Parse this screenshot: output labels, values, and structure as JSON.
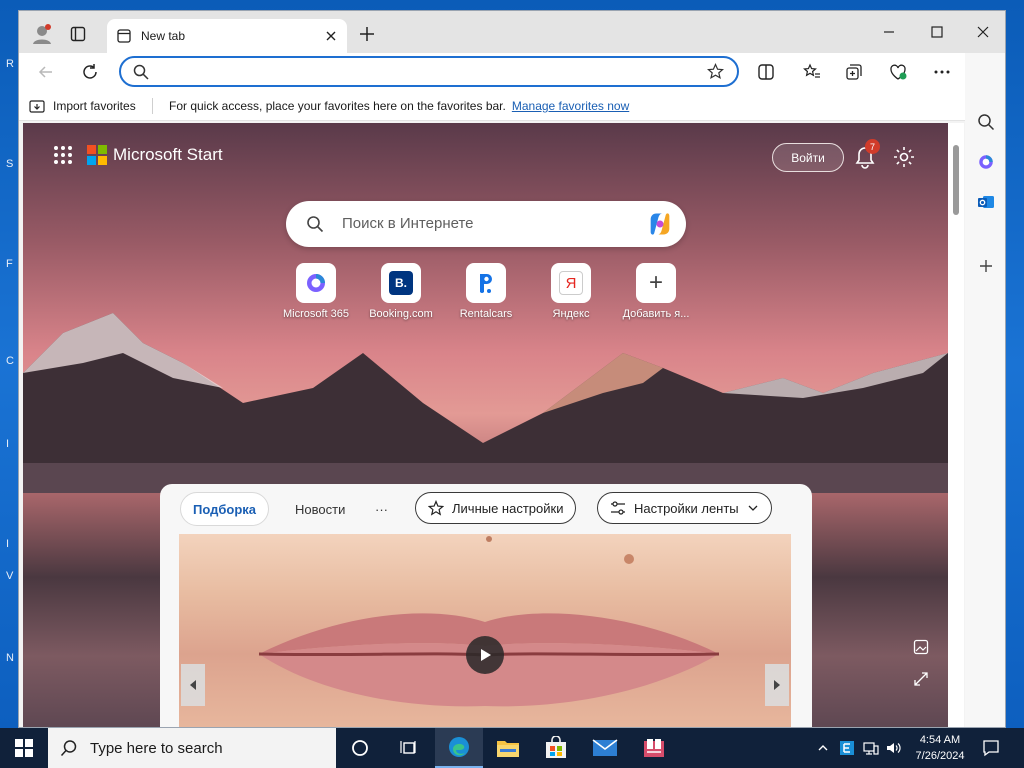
{
  "desktop": {
    "letters": [
      {
        "text": "R"
      },
      {
        "text": "S"
      },
      {
        "text": "F"
      },
      {
        "text": "C"
      },
      {
        "text": "I"
      },
      {
        "text": "I"
      },
      {
        "text": "V"
      },
      {
        "text": "N"
      }
    ]
  },
  "browser": {
    "tab": {
      "title": "New tab"
    },
    "address": {
      "value": "",
      "placeholder": ""
    },
    "favorites_bar": {
      "import_label": "Import favorites",
      "prompt_text": "For quick access, place your favorites here on the favorites bar.",
      "manage_link": "Manage favorites now"
    }
  },
  "start_page": {
    "brand": "Microsoft Start",
    "sign_in_label": "Войти",
    "notification_count": "7",
    "search": {
      "placeholder": "Поиск в Интернете"
    },
    "quick_links": [
      {
        "label": "Microsoft 365",
        "icon": "microsoft-365-icon"
      },
      {
        "label": "Booking.com",
        "icon": "booking-icon",
        "glyph": "B."
      },
      {
        "label": "Rentalcars",
        "icon": "rentalcars-icon"
      },
      {
        "label": "Яндекс",
        "icon": "yandex-icon",
        "glyph": "Я"
      },
      {
        "label": "Добавить я...",
        "icon": "plus-icon",
        "glyph": "+"
      }
    ],
    "feed": {
      "tabs": [
        {
          "label": "Подборка",
          "active": true
        },
        {
          "label": "Новости",
          "active": false
        },
        {
          "label": "···",
          "active": false
        }
      ],
      "personalize_label": "Личные настройки",
      "feed_settings_label": "Настройки ленты"
    }
  },
  "taskbar": {
    "search_placeholder": "Type here to search",
    "clock_time": "4:54 AM",
    "clock_date": "7/26/2024",
    "apps": [
      "cortana-icon",
      "task-view-icon",
      "edge-icon",
      "file-explorer-icon",
      "store-icon",
      "mail-icon",
      "app-icon"
    ]
  },
  "colors": {
    "accent": "#1e6fd1",
    "taskbar": "#10213a",
    "badge": "#d13b2a"
  }
}
